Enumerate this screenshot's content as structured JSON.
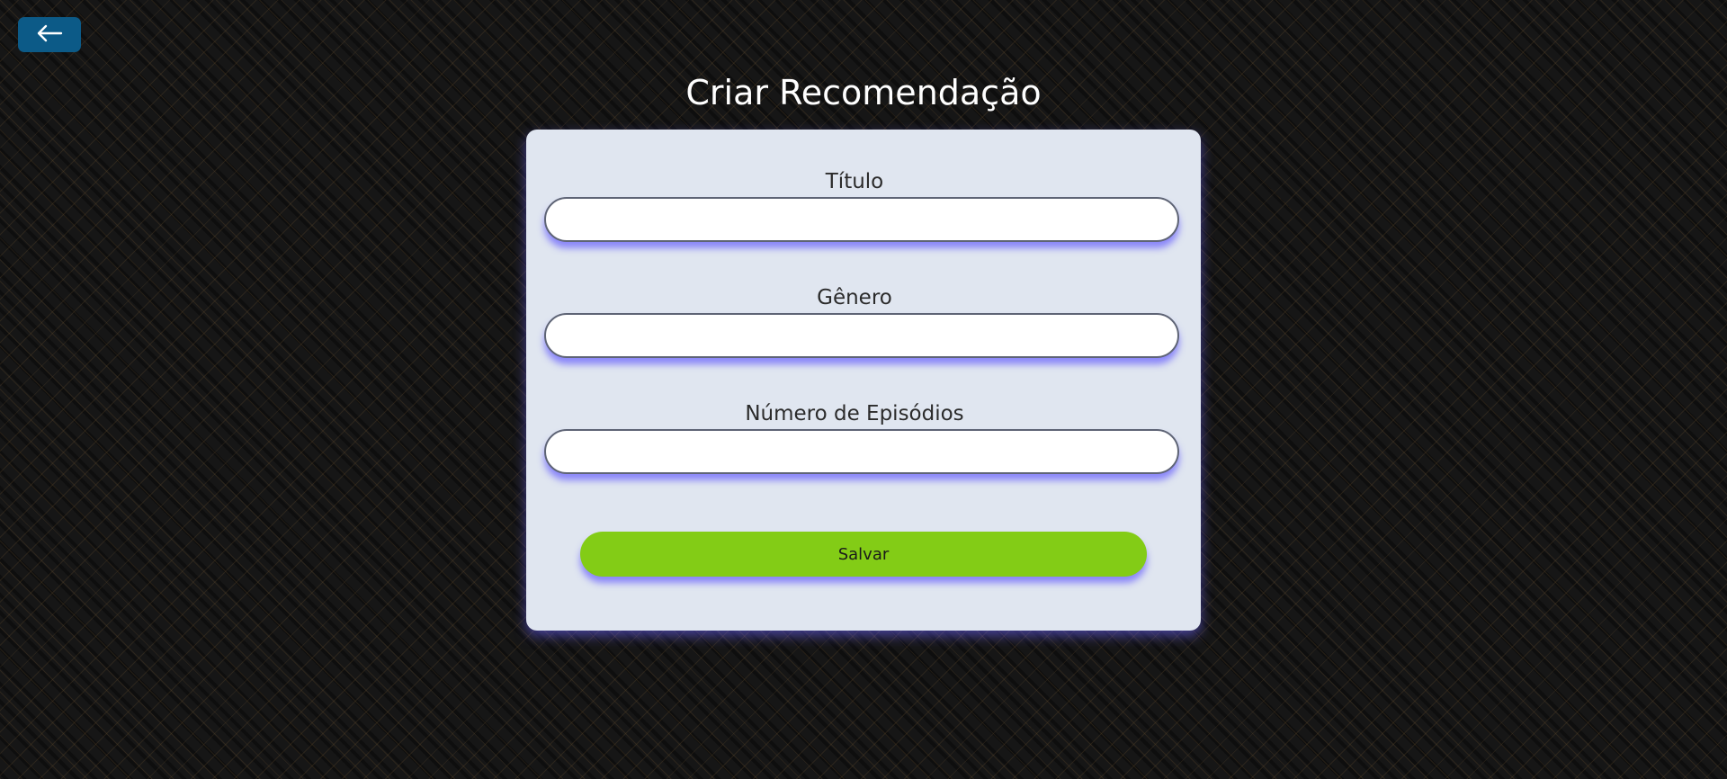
{
  "header": {
    "back_icon": "arrow-left-icon",
    "title": "Criar Recomendação"
  },
  "form": {
    "fields": [
      {
        "label": "Título",
        "value": "",
        "placeholder": ""
      },
      {
        "label": "Gênero",
        "value": "",
        "placeholder": ""
      },
      {
        "label": "Número de Episódios",
        "value": "",
        "placeholder": ""
      }
    ],
    "submit_label": "Salvar"
  },
  "colors": {
    "back_button": "#0c5a87",
    "card": "#e0e6f0",
    "save_button": "#83cc16",
    "glow": "#5046ff"
  }
}
